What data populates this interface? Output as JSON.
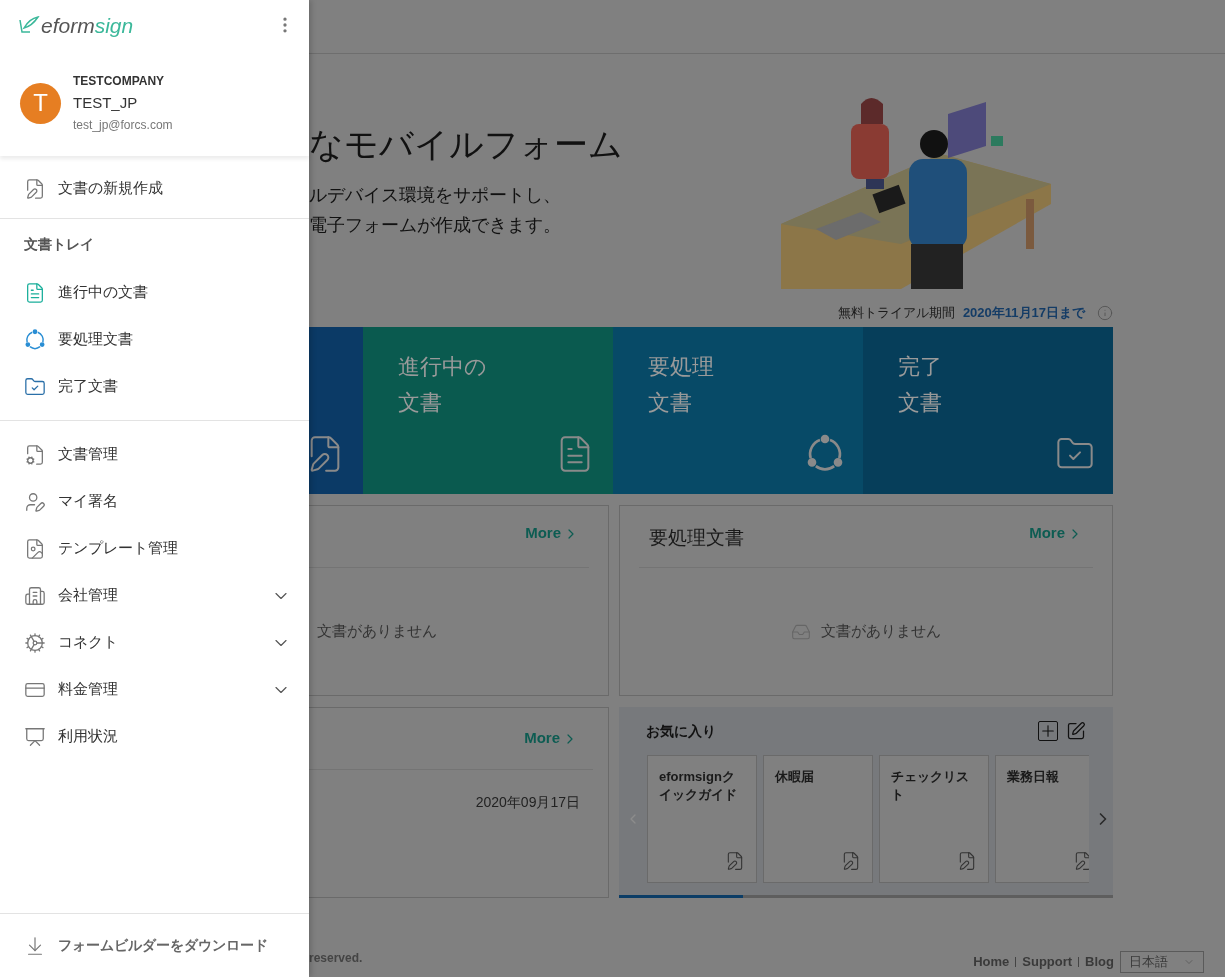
{
  "drawer": {
    "logo": {
      "part_1": "eform",
      "part_2": "sign"
    },
    "profile": {
      "initial": "T",
      "company": "TESTCOMPANY",
      "name": "TEST_JP",
      "email": "test_jp@forcs.com"
    },
    "new_document": {
      "kind": "new",
      "label": "文書の新規作成"
    },
    "tray_heading": "文書トレイ",
    "tray_items": [
      {
        "kind": "progress",
        "label": "進行中の文書"
      },
      {
        "kind": "action",
        "label": "要処理文書"
      },
      {
        "kind": "done",
        "label": "完了文書"
      }
    ],
    "menu_items": [
      {
        "kind": "doc-manage",
        "label": "文書管理"
      },
      {
        "kind": "signature",
        "label": "マイ署名"
      },
      {
        "kind": "template",
        "label": "テンプレート管理"
      },
      {
        "kind": "company",
        "label": "会社管理",
        "expanded": false
      },
      {
        "kind": "connect",
        "label": "コネクト",
        "expanded": false
      },
      {
        "kind": "billing",
        "label": "料金管理",
        "expanded": false
      },
      {
        "kind": "usage",
        "label": "利用状況"
      }
    ],
    "download": "フォームビルダーをダウンロード"
  },
  "hero": {
    "title": "なモバイルフォーム",
    "lines": [
      "ルデバイス環境をサポートし、",
      "電子フォームが作成できます。"
    ]
  },
  "trial": {
    "label": "無料トライアル期間",
    "until": "2020年11月17日まで"
  },
  "tiles": [
    {
      "kind": "new"
    },
    {
      "kind": "progress",
      "lines": [
        "進行中の",
        "文書"
      ]
    },
    {
      "kind": "action",
      "lines": [
        "要処理",
        "文書"
      ]
    },
    {
      "kind": "done",
      "lines": [
        "完了",
        "文書"
      ]
    }
  ],
  "panels": [
    {
      "more": "More",
      "empty": "文書がありません"
    },
    {
      "title": "要処理文書",
      "more": "More",
      "empty": "文書がありません"
    }
  ],
  "recent": {
    "more": "More",
    "date": "2020年09月17日"
  },
  "favorites": {
    "title": "お気に入り",
    "cards": [
      "eformsignクイックガイド",
      "休暇届",
      "チェックリスト",
      "業務日報"
    ],
    "level": 0.25
  },
  "footer": {
    "copyright": "reserved.",
    "links": [
      "Home",
      "Support",
      "Blog"
    ],
    "language": "日本語"
  }
}
